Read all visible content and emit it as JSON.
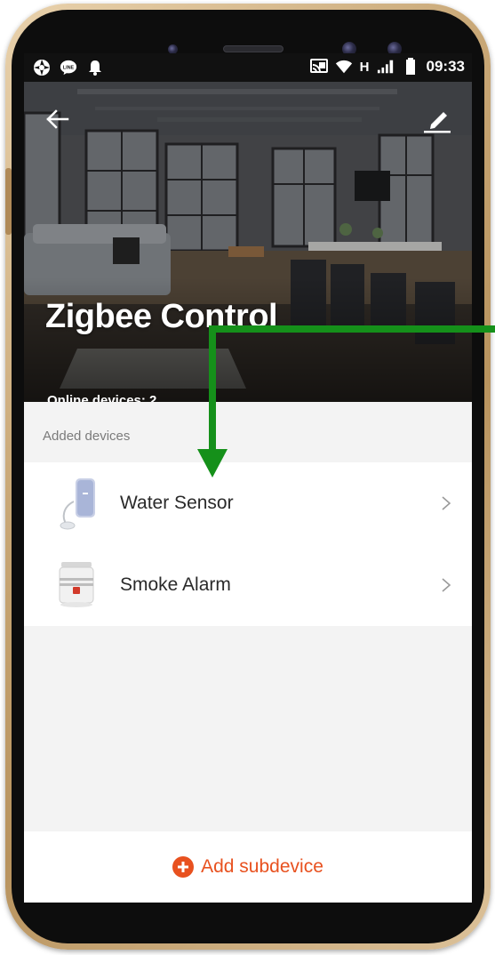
{
  "status_bar": {
    "time": "09:33",
    "network_type": "H",
    "left_icons": [
      "aperture-icon",
      "line-app-icon",
      "bell-icon"
    ],
    "right_icons": [
      "cast-icon",
      "wifi-icon",
      "signal-icon",
      "battery-icon"
    ]
  },
  "header": {
    "title": "Zigbee Control",
    "online_devices": "Online devices: 2",
    "back_icon": "back-arrow-icon",
    "edit_icon": "edit-pencil-icon"
  },
  "devices_section": {
    "header": "Added devices",
    "items": [
      {
        "label": "Water Sensor",
        "icon": "water-sensor-icon"
      },
      {
        "label": "Smoke Alarm",
        "icon": "smoke-alarm-icon"
      }
    ]
  },
  "footer": {
    "add_label": "Add subdevice"
  },
  "colors": {
    "accent": "#e8511f",
    "annotation_arrow": "#15901a",
    "phone_frame": "#c9a877"
  }
}
